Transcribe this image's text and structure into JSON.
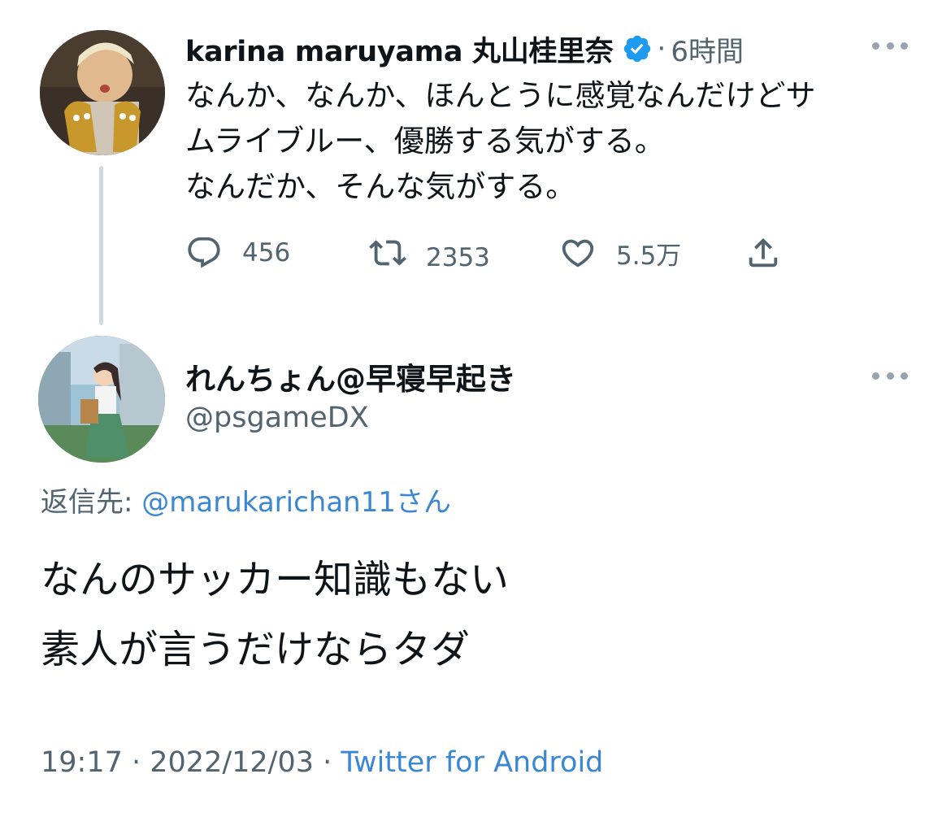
{
  "parent_tweet": {
    "author_name": "karina maruyama 丸山桂里奈",
    "separator": "·",
    "time_ago": "6時間",
    "text_lines": [
      "なんか、なんか、ほんとうに感覚なんだけどサ",
      "ムライブルー、優勝する気がする。",
      "なんだか、そんな気がする。"
    ],
    "reply_count": "456",
    "retweet_count": "2353",
    "like_count": "5.5万",
    "icons": {
      "verified": "verified-badge-icon",
      "reply": "reply-bubble-icon",
      "retweet": "retweet-icon",
      "like": "heart-icon",
      "share": "share-icon",
      "more": "more-dots-icon"
    }
  },
  "reply_tweet": {
    "author_name": "れんちょん@早寝早起き",
    "handle": "@psgameDX",
    "reply_to_label": "返信先: ",
    "reply_to_mention": "@marukarichan11",
    "reply_to_suffix": "さん",
    "text_lines": [
      "なんのサッカー知識もない",
      "素人が言うだけならタダ"
    ],
    "time": "19:17",
    "date": "2022/12/03",
    "separator": " · ",
    "client": "Twitter for Android"
  },
  "colors": {
    "text_primary": "#0f1419",
    "text_secondary": "#536471",
    "link": "#3b87d3",
    "verified": "#1d9bf0",
    "thread_line": "#cfd9de"
  }
}
